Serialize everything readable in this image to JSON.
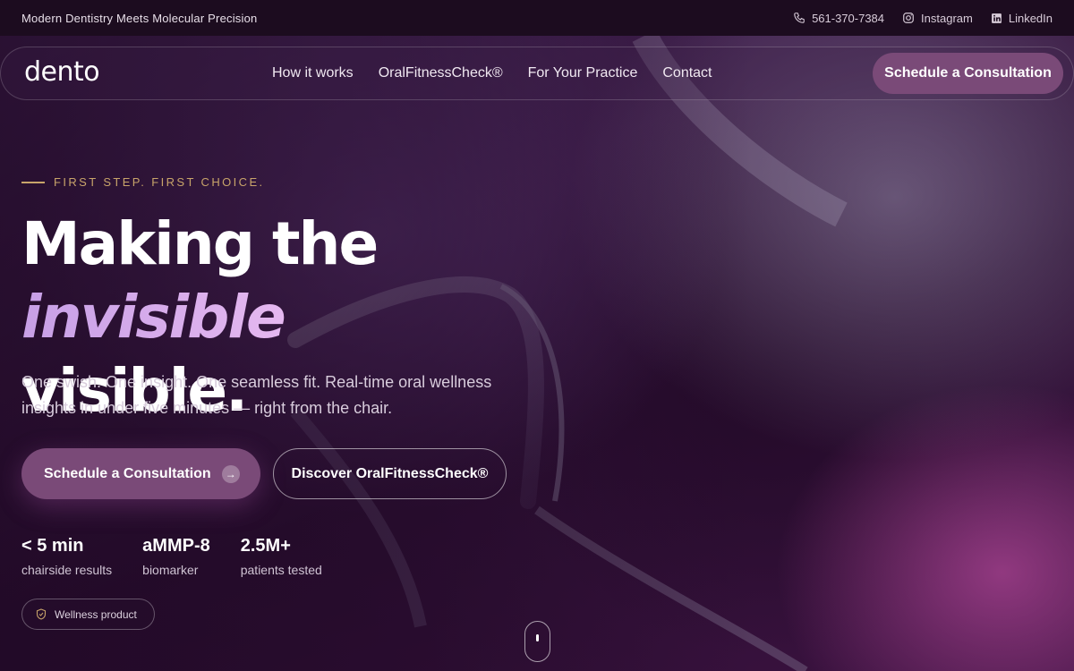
{
  "topbar": {
    "tagline": "Modern Dentistry Meets Molecular Precision",
    "phone": "561-370-7384",
    "instagram": "Instagram",
    "linkedin": "LinkedIn"
  },
  "nav": {
    "logo": "dento",
    "items": [
      {
        "label": "How it works"
      },
      {
        "label": "OralFitnessCheck®"
      },
      {
        "label": "For Your Practice"
      },
      {
        "label": "Contact"
      }
    ],
    "cta": "Schedule a Consultation"
  },
  "hero": {
    "eyebrow": "FIRST STEP. FIRST CHOICE.",
    "headline_part1": "Making the ",
    "headline_accent": "invisible",
    "headline_part2": "visible.",
    "subtitle": "One swish. One insight. One seamless fit. Real-time oral wellness insights in under five minutes — right from the chair.",
    "primary_cta": "Schedule a Consultation",
    "secondary_cta": "Discover OralFitnessCheck®",
    "stats": [
      {
        "value": "< 5 min",
        "label": "chairside results"
      },
      {
        "value": "aMMP-8",
        "label": "biomarker"
      },
      {
        "value": "2.5M+",
        "label": "patients tested"
      }
    ],
    "badge": "Wellness product"
  },
  "colors": {
    "accent_button": "#7a4a78",
    "eyebrow_gold": "#c8a46a",
    "headline_accent": "#d0a8ea",
    "topbar_bg": "#1c0c1f"
  },
  "icons": {
    "phone": "phone-icon",
    "instagram": "instagram-icon",
    "linkedin": "linkedin-icon",
    "arrow": "arrow-right-icon",
    "shield": "shield-icon",
    "scroll": "scroll-mouse-icon"
  }
}
